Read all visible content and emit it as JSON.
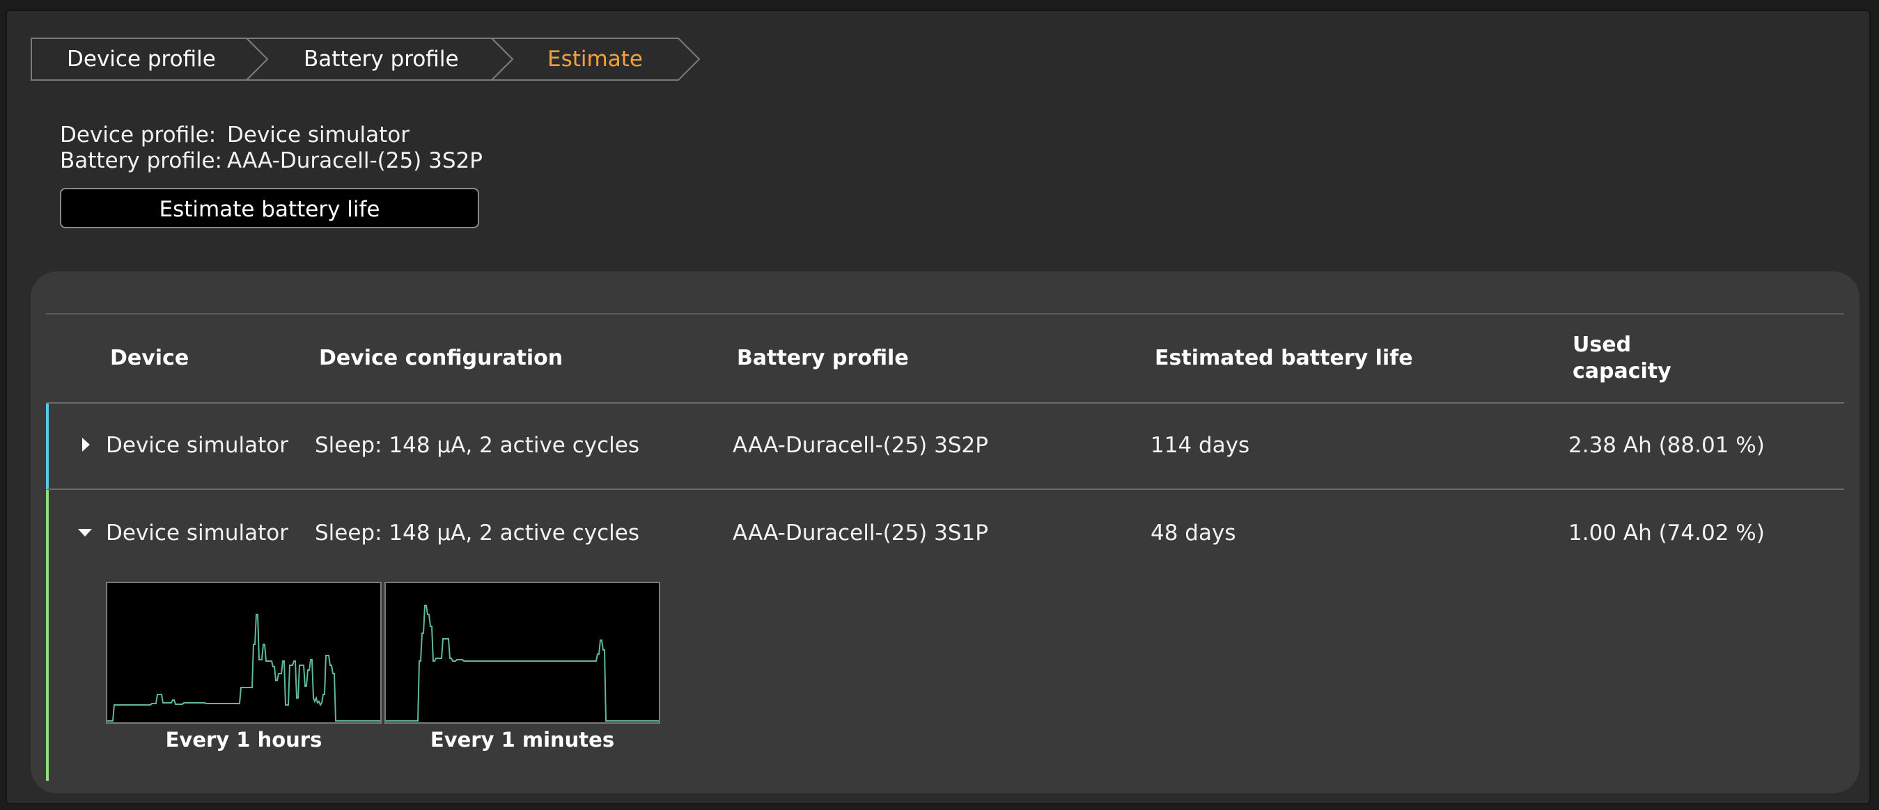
{
  "breadcrumb": {
    "steps": [
      {
        "label": "Device profile"
      },
      {
        "label": "Battery profile"
      },
      {
        "label": "Estimate"
      }
    ]
  },
  "profile_info": {
    "device_key": "Device profile:",
    "device_value": "Device simulator",
    "battery_key": "Battery profile:",
    "battery_value": "AAA-Duracell-(25) 3S2P"
  },
  "estimate_button": {
    "label": "Estimate battery life"
  },
  "table": {
    "headers": {
      "device": "Device",
      "config": "Device configuration",
      "battery": "Battery profile",
      "life": "Estimated battery life",
      "used_line1": "Used",
      "used_line2": "capacity"
    },
    "rows": [
      {
        "expanded": false,
        "device": "Device simulator",
        "config": "Sleep: 148 μA, 2 active cycles",
        "battery": "AAA-Duracell-(25) 3S2P",
        "life": "114 days",
        "used": "2.38 Ah (88.01 %)"
      },
      {
        "expanded": true,
        "device": "Device simulator",
        "config": "Sleep: 148 μA, 2 active cycles",
        "battery": "AAA-Duracell-(25) 3S1P",
        "life": "48 days",
        "used": "1.00 Ah (74.02 %)",
        "charts": [
          {
            "caption": "Every 1 hours"
          },
          {
            "caption": "Every 1 minutes"
          }
        ]
      }
    ]
  },
  "colors": {
    "active_step": "#f2a13b",
    "row1_accent": "#5bc8e8",
    "row2_accent": "#8fe07a",
    "trace": "#5fb89a"
  }
}
